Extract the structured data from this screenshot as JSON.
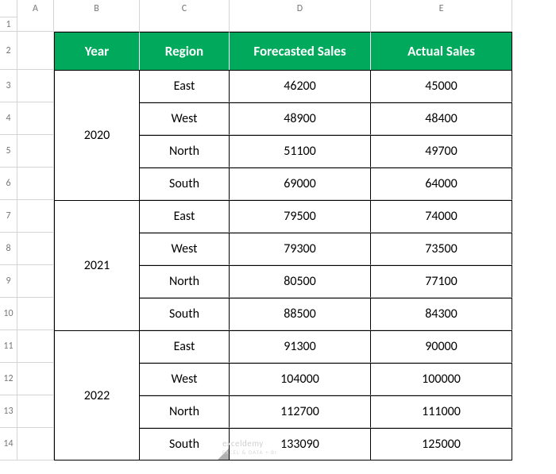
{
  "columns": [
    "A",
    "B",
    "C",
    "D",
    "E"
  ],
  "rows": [
    "1",
    "2",
    "3",
    "4",
    "5",
    "6",
    "7",
    "8",
    "9",
    "10",
    "11",
    "12",
    "13",
    "14"
  ],
  "headers": {
    "year": "Year",
    "region": "Region",
    "forecasted": "Forecasted Sales",
    "actual": "Actual Sales"
  },
  "data": {
    "years": [
      "2020",
      "2021",
      "2022"
    ],
    "groups": [
      [
        {
          "region": "East",
          "forecast": "46200",
          "actual": "45000"
        },
        {
          "region": "West",
          "forecast": "48900",
          "actual": "48400"
        },
        {
          "region": "North",
          "forecast": "51100",
          "actual": "49700"
        },
        {
          "region": "South",
          "forecast": "69000",
          "actual": "64000"
        }
      ],
      [
        {
          "region": "East",
          "forecast": "79500",
          "actual": "74000"
        },
        {
          "region": "West",
          "forecast": "79300",
          "actual": "73500"
        },
        {
          "region": "North",
          "forecast": "80500",
          "actual": "77100"
        },
        {
          "region": "South",
          "forecast": "88500",
          "actual": "84300"
        }
      ],
      [
        {
          "region": "East",
          "forecast": "91300",
          "actual": "90000"
        },
        {
          "region": "West",
          "forecast": "104000",
          "actual": "100000"
        },
        {
          "region": "North",
          "forecast": "112700",
          "actual": "111000"
        },
        {
          "region": "South",
          "forecast": "133090",
          "actual": "125000"
        }
      ]
    ]
  },
  "watermark": {
    "main": "exceldemy",
    "sub": "EXCEL & DATA + BI"
  }
}
